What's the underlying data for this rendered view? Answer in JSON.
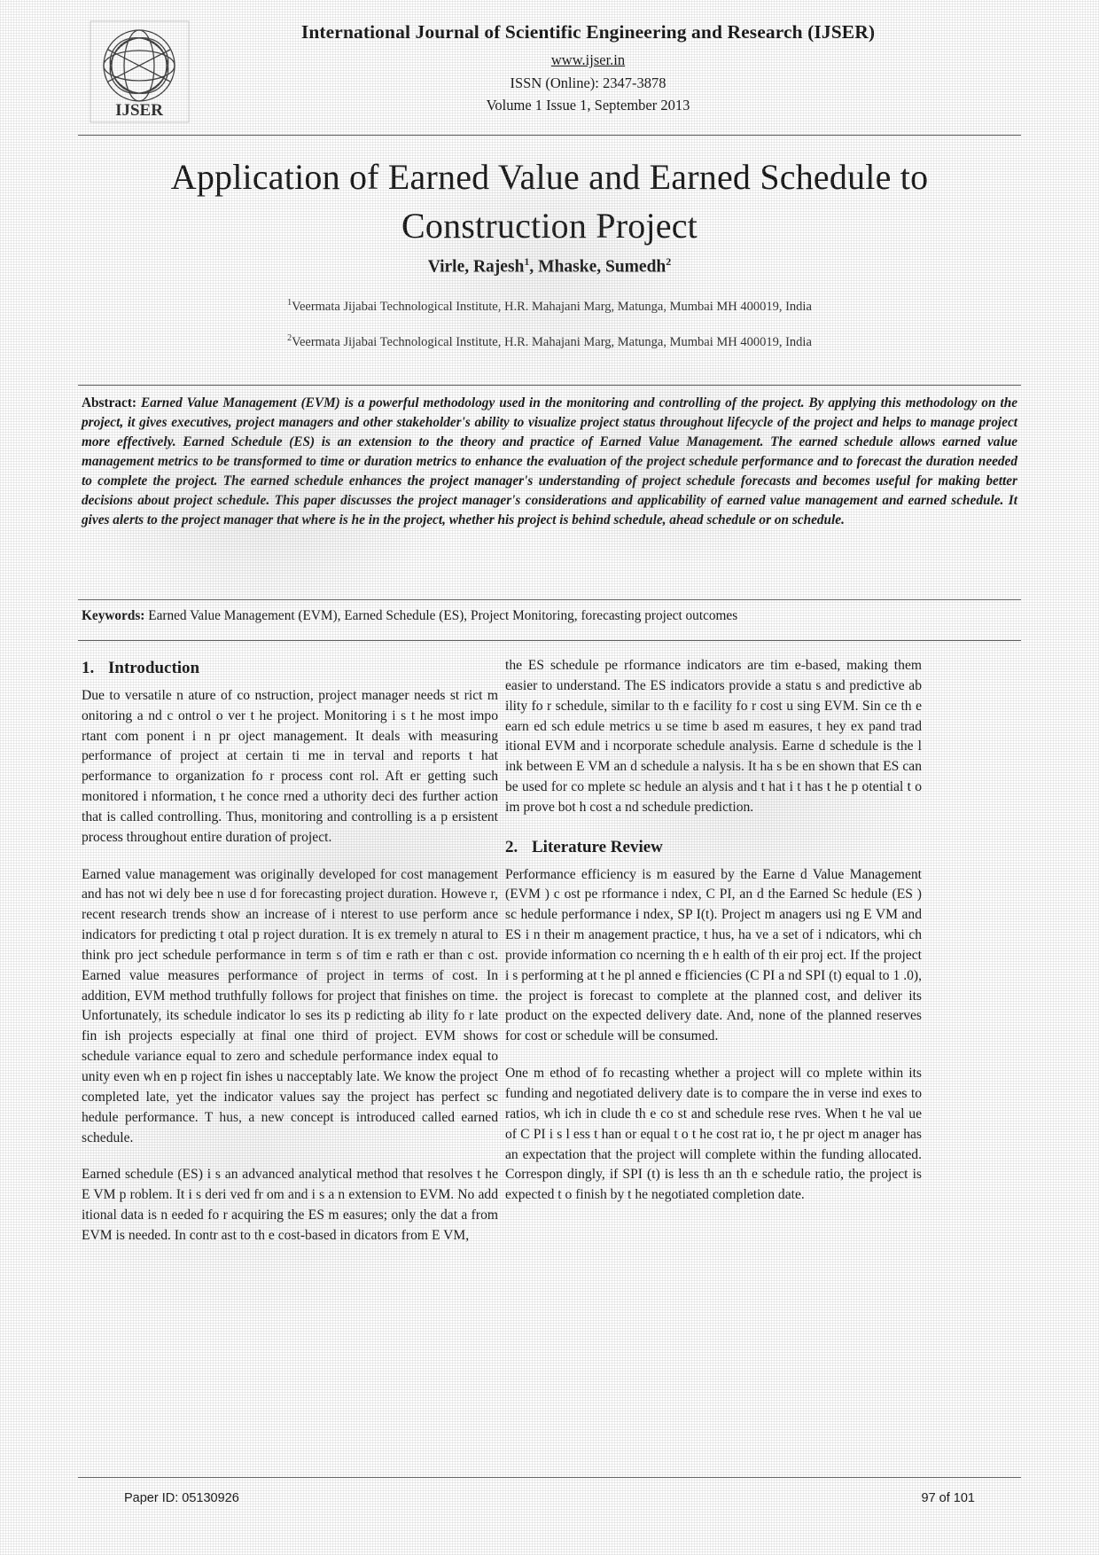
{
  "header": {
    "journal_title": "International Journal of Scientific Engineering and Research (IJSER)",
    "url": "www.ijser.in",
    "issn": "ISSN (Online): 2347-3878",
    "volume": "Volume 1 Issue 1, September 2013",
    "logo_text": "IJSER"
  },
  "paper": {
    "title": "Application of Earned Value and Earned Schedule to Construction Project",
    "authors_line": "Virle, Rajesh",
    "author1": "Virle, Rajesh",
    "author1_sup": "1",
    "author2": "Mhaske, Sumedh",
    "author2_sup": "2",
    "affiliation1_sup": "1",
    "affiliation1": "Veermata Jijabai Technological Institute, H.R. Mahajani Marg, Matunga, Mumbai MH 400019, India",
    "affiliation2_sup": "2",
    "affiliation2": "Veermata Jijabai Technological Institute, H.R. Mahajani Marg, Matunga, Mumbai MH 400019, India"
  },
  "abstract": {
    "label": "Abstract:",
    "text": "Earned Value Management (EVM) is a powerful methodology used in the monitoring and controlling of the project. By applying this methodology on the project, it gives executives, project managers and other stakeholder's ability to visualize project status throughout lifecycle of the project and helps to manage project more effectively. Earned Schedule (ES) is an extension to the theory and practice of Earned Value Management. The earned schedule allows earned value management metrics to be transformed to time or duration metrics to enhance the evaluation of the project schedule performance and to forecast the duration needed to complete the project. The earned schedule enhances the project manager's understanding of project schedule forecasts and becomes useful for making better decisions about project schedule. This paper discusses the project manager's considerations and applicability of earned value management and earned schedule. It gives alerts to the project manager that where is he in the project, whether his project is behind schedule, ahead schedule or on schedule."
  },
  "keywords": {
    "label": "Keywords:",
    "text": "Earned Value Management (EVM), Earned Schedule (ES), Project Monitoring, forecasting project outcomes"
  },
  "sections": {
    "intro": {
      "number": "1.",
      "title": "Introduction",
      "p1": "Due to  versatile n ature of co  nstruction,  project  manager needs st rict m onitoring a nd c ontrol o ver t he  project. Monitoring i s t he  most impo rtant com ponent i n pr oject management. It deals with measuring performance of project at certain  ti me in terval and   reports t hat  performance to organization fo r  process cont rol. Aft er  getting  such monitored i nformation, t he conce rned a uthority deci des further action that is called controlling. Thus, monitoring and controlling is  a p ersistent process throughout entire duration of project.",
      "p2": "Earned value management was originally developed for cost management and  has not wi dely bee n use d for  forecasting project duration. Howeve r,  recent research trends show  an increase  of i nterest to   use perform ance indicators  for predicting t otal p roject  duration. It is ex tremely n atural to think pro ject  schedule  performance in  term s of tim e rath er than c ost. Earned value measures performance of project in terms of cost. In addition,  EVM method truthfully follows for project that finishes on time. Unfortunately, its schedule indicator lo ses its p redicting ab ility fo r late fin ish projects especially at final one third of project. EVM shows schedule variance equal to zero and schedule performance index equal to unity even wh en p roject fin ishes u nacceptably late. We know the project completed late, yet the indicator values say the project  has perfect sc hedule performance. T hus, a new concept is introduced called earned schedule.",
      "p3": "Earned schedule (ES) i s an advanced analytical method that resolves t he E VM p roblem. It  i s deri ved fr om and i  s a n extension to   EVM.  No add itional  data is n  eeded fo r acquiring the  ES m easures; only the dat  a from  EVM is needed. In contr ast to th e cost-based in dicators from E VM,"
    },
    "intro_right": {
      "p1": "the ES   schedule pe rformance indicators   are tim e-based, making them easier to understand. The ES indicators provide a statu s and  predictive ab ility fo r  schedule, similar to  th e facility fo r cost u  sing EVM. Sin  ce th e earn ed sch edule metrics u se time b  ased m easures, t hey ex pand trad itional EVM and i ncorporate schedule analysis. Earne d schedule is the l ink  between E VM an d  schedule a nalysis. It  ha s be en shown that ES can be   used  for co mplete sc hedule an alysis and t hat i t has t  he p otential t o im prove bot h cost  a nd schedule prediction."
    },
    "literature": {
      "number": "2.",
      "title": "Literature Review",
      "p1": "Performance efficiency is m  easured  by the Earne d  Value Management (EVM ) c ost pe rformance i ndex, C PI, an d the Earned Sc hedule (ES ) sc hedule  performance i ndex, SP I(t). Project m anagers usi ng E VM and ES i  n their m anagement practice, t hus, ha ve a set   of i ndicators, whi ch  provide information co ncerning th e h ealth  of th eir proj ect.  If the project i s  performing at  t he pl anned e fficiencies (C PI a nd SPI (t) equal to 1 .0), the project is forecast to complete at the planned cost, and deliver its product on the expected delivery date. And, none of the planned reserves for cost or schedule will be consumed.",
      "p2": "One m ethod of fo recasting  whether a project will co  mplete within its funding and negotiated delivery date is to compare the in verse ind exes to  ratios, wh  ich in clude th e co st and schedule rese rves.  When t he val ue of C PI i s l ess t han or equal t o t he cost  rat io, t he pr oject m anager  has an expectation that the project will complete within the funding allocated. Correspon dingly, if SPI (t) is less th        an th e schedule ratio,  the project is   expected t o  finish by t  he negotiated completion date."
    }
  },
  "footer": {
    "paper_id": "Paper ID: 05130926",
    "page": "97 of 101"
  }
}
